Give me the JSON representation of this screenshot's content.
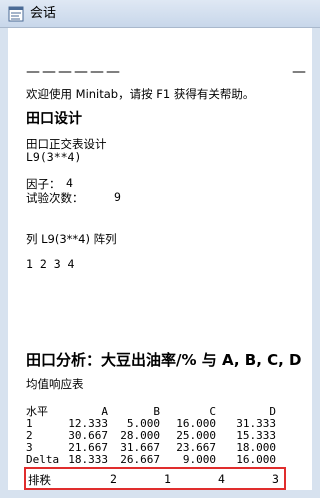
{
  "window": {
    "title": "会话",
    "app_icon": "session-window-icon"
  },
  "session": {
    "dashes_left": "——————",
    "dashes_right": "—",
    "welcome": "欢迎使用 Minitab，请按 F1 获得有关帮助。",
    "design_heading": "田口设计",
    "design_subheading": "田口正交表设计",
    "array_code": "L9(3**4)",
    "factors_label": "因子：",
    "factors_value": "4",
    "runs_label": "试验次数：",
    "runs_value": "9",
    "columns_label": "列 L9(3**4) 阵列",
    "columns_values": "1 2 3 4",
    "analysis_heading": "田口分析：大豆出油率/% 与 A, B, C, D",
    "response_table_heading": "均值响应表",
    "table": {
      "header": [
        "水平",
        "A",
        "B",
        "C",
        "D"
      ],
      "rows": [
        [
          "1",
          "12.333",
          "5.000",
          "16.000",
          "31.333"
        ],
        [
          "2",
          "30.667",
          "28.000",
          "25.000",
          "15.333"
        ],
        [
          "3",
          "21.667",
          "31.667",
          "23.667",
          "18.000"
        ],
        [
          "Delta",
          "18.333",
          "26.667",
          "9.000",
          "16.000"
        ]
      ],
      "rank": [
        "排秩",
        "2",
        "1",
        "4",
        "3"
      ]
    }
  },
  "colors": {
    "titlebar": "#cfdcec",
    "frame": "#d7e2ef",
    "highlight_box": "#e02d2d"
  }
}
